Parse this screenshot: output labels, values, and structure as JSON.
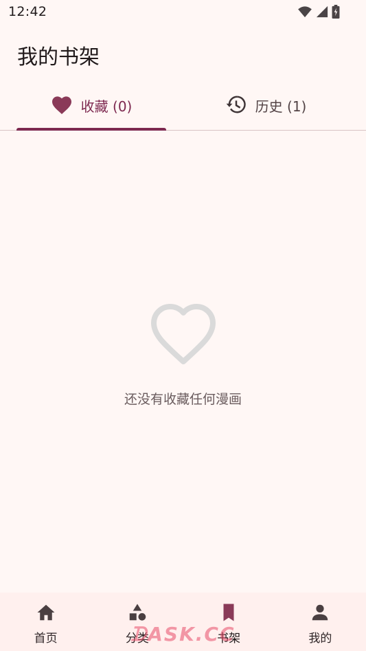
{
  "status": {
    "time": "12:42",
    "icons": [
      "wifi-icon",
      "signal-icon",
      "battery-icon"
    ]
  },
  "header": {
    "title": "我的书架"
  },
  "tabs": [
    {
      "label": "收藏 (0)",
      "icon": "heart-icon",
      "selected": true
    },
    {
      "label": "历史 (1)",
      "icon": "history-icon",
      "selected": false
    }
  ],
  "empty_state": {
    "icon": "heart-outline-icon",
    "message": "还没有收藏任何漫画"
  },
  "bottom_nav": {
    "items": [
      {
        "label": "首页",
        "icon": "home-icon",
        "active": false
      },
      {
        "label": "分类",
        "icon": "category-icon",
        "active": false
      },
      {
        "label": "书架",
        "icon": "bookmark-icon",
        "active": true
      },
      {
        "label": "我的",
        "icon": "person-icon",
        "active": false
      }
    ]
  },
  "watermark": {
    "text": "ᗪASK.CC"
  },
  "colors": {
    "background": "#fff7f5",
    "primary": "#7d2950",
    "active_tab_icon": "#8a3a58",
    "empty_icon": "#dadada",
    "bottom_nav_bg": "#fff0ee",
    "nav_icon": "#4a3f41"
  }
}
